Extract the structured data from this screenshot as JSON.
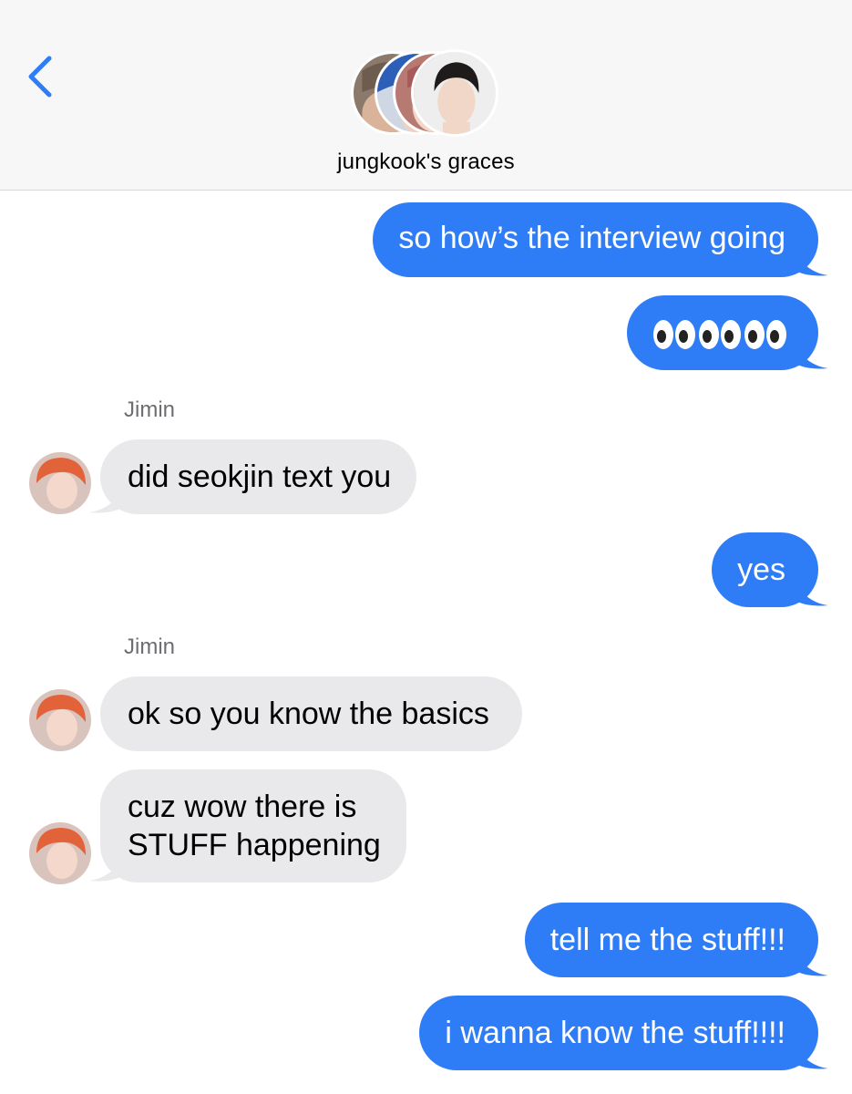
{
  "header": {
    "group_name": "jungkook's graces",
    "back_icon": "chevron-left-icon",
    "accent": "#2f7df6"
  },
  "colors": {
    "sent_bubble": "#2f7df6",
    "received_bubble": "#e9e9eb",
    "sender_name": "#6d6d72"
  },
  "messages": [
    {
      "dir": "sent",
      "text": "so how’s the interview going"
    },
    {
      "dir": "sent",
      "text": "👀👀👀"
    },
    {
      "dir": "received",
      "sender": "Jimin",
      "text": "did seokjin text you"
    },
    {
      "dir": "sent",
      "text": "yes"
    },
    {
      "dir": "received",
      "sender": "Jimin",
      "text": "ok so you know the basics"
    },
    {
      "dir": "received",
      "text": "cuz wow there is STUFF happening",
      "lines": [
        "cuz wow there is",
        "STUFF happening"
      ]
    },
    {
      "dir": "sent",
      "text": "tell me the stuff!!!"
    },
    {
      "dir": "sent",
      "text": "i wanna know the stuff!!!!"
    }
  ]
}
